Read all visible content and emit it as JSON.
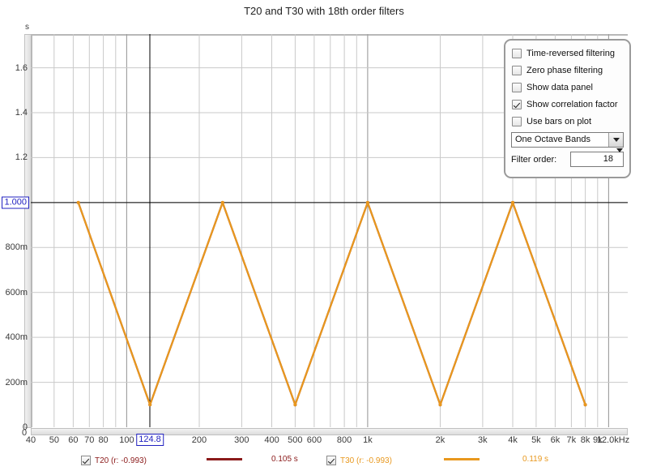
{
  "chart_data": {
    "type": "line",
    "title": "T20 and T30 with 18th order filters",
    "xlabel": "",
    "ylabel": "s",
    "x_scale": "log",
    "xlim": [
      40,
      12000
    ],
    "ylim": [
      0,
      1.75
    ],
    "grid": true,
    "y_unit": "s",
    "x_ticks": [
      "40",
      "50",
      "60",
      "70",
      "80",
      "100",
      "200",
      "300",
      "400",
      "500",
      "600",
      "800",
      "1k",
      "2k",
      "3k",
      "4k",
      "5k",
      "6k",
      "7k",
      "8k",
      "9k",
      "12.0kHz"
    ],
    "x_tick_values": [
      40,
      50,
      60,
      70,
      80,
      100,
      200,
      300,
      400,
      500,
      600,
      800,
      1000,
      2000,
      3000,
      4000,
      5000,
      6000,
      7000,
      8000,
      9000,
      12000
    ],
    "y_ticks": [
      "0",
      "200m",
      "400m",
      "600m",
      "800m",
      "1.000",
      "1.2",
      "1.4",
      "1.6"
    ],
    "y_tick_values": [
      0,
      0.2,
      0.4,
      0.6,
      0.8,
      1.0,
      1.2,
      1.4,
      1.6
    ],
    "cursor": {
      "x_label": "124.8",
      "y_label": "1.000",
      "x_value": 124.8,
      "y_value": 1.0
    },
    "categories": [
      63,
      125,
      250,
      500,
      1000,
      2000,
      4000,
      8000
    ],
    "series": [
      {
        "name": "T20",
        "color": "#8B1A1A",
        "values": [
          1.0,
          0.1,
          1.0,
          0.1,
          1.0,
          0.1,
          1.0,
          0.1
        ],
        "correlation": "r: -0.993",
        "readout": "0.105 s"
      },
      {
        "name": "T30",
        "color": "#E8981E",
        "values": [
          1.0,
          0.1,
          1.0,
          0.1,
          1.0,
          0.1,
          1.0,
          0.1
        ],
        "correlation": "r: -0.993",
        "readout": "0.119 s"
      }
    ]
  },
  "panel": {
    "checkboxes": [
      {
        "label": "Time-reversed filtering",
        "checked": false
      },
      {
        "label": "Zero phase filtering",
        "checked": false
      },
      {
        "label": "Show data panel",
        "checked": false
      },
      {
        "label": "Show correlation factor",
        "checked": true
      },
      {
        "label": "Use bars on plot",
        "checked": false
      }
    ],
    "band_select": "One Octave Bands",
    "filter_order_label": "Filter order:",
    "filter_order_value": "18"
  },
  "legend": [
    {
      "name": "T20",
      "corr": "(r: -0.993)",
      "value": "0.105 s",
      "color": "#8B1A1A",
      "checked": true
    },
    {
      "name": "T30",
      "corr": "(r: -0.993)",
      "value": "0.119 s",
      "color": "#E8981E",
      "checked": true
    }
  ]
}
